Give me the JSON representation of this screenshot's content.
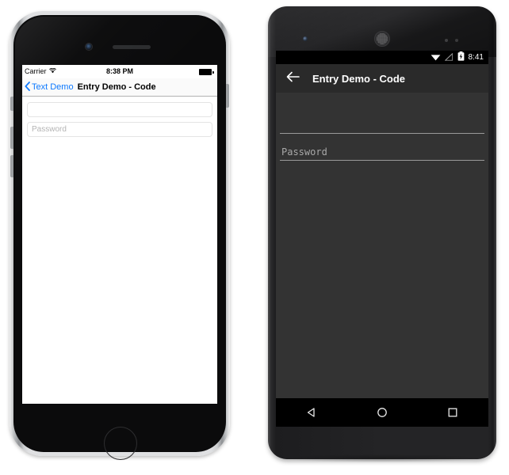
{
  "page": {
    "title": "Entry Demo - Code"
  },
  "ios_device": {
    "name": "iphone-device",
    "status_bar": {
      "carrier": "Carrier",
      "wifi_icon": "wifi-icon",
      "time": "8:38 PM",
      "battery_icon": "battery-full-icon"
    },
    "nav_bar": {
      "back_icon": "chevron-left-icon",
      "back_label": "Text Demo",
      "title": "Entry Demo - Code"
    },
    "content": {
      "fields": [
        {
          "name": "entry-field",
          "value": "",
          "placeholder": ""
        },
        {
          "name": "password-field",
          "value": "",
          "placeholder": "Password"
        }
      ]
    },
    "hardware": {
      "camera": "front-camera",
      "speaker": "earpiece-speaker",
      "home_button": "home-button",
      "power_button": "power-button",
      "volume_up": "volume-up-button",
      "volume_down": "volume-down-button",
      "ring_switch": "ring-silent-switch"
    }
  },
  "android_device": {
    "name": "android-device",
    "status_bar": {
      "wifi_icon": "wifi-icon",
      "signal_icon": "signal-off-icon",
      "battery_icon": "battery-charging-icon",
      "time": "8:41"
    },
    "app_bar": {
      "back_icon": "arrow-left-icon",
      "title": "Entry Demo - Code"
    },
    "content": {
      "fields": [
        {
          "name": "entry-field",
          "value": "",
          "placeholder": ""
        },
        {
          "name": "password-field",
          "value": "",
          "placeholder": "Password"
        }
      ]
    },
    "nav_bar": {
      "back": "back-triangle-icon",
      "home": "home-circle-icon",
      "recents": "recents-square-icon"
    },
    "hardware": {
      "camera": "front-camera",
      "speaker": "earpiece-speaker",
      "sensors": "proximity-sensors"
    }
  },
  "colors": {
    "ios_accent": "#0b78ff",
    "ios_nav_bg": "#fafafa",
    "ios_screen_bg": "#ffffff",
    "ios_placeholder": "#b4b4b4",
    "android_appbar_bg": "#2a2a2a",
    "android_screen_bg": "#333333",
    "android_statusbar_bg": "#000000",
    "android_placeholder": "#a8a8a8",
    "page_bg": "#ffffff"
  }
}
